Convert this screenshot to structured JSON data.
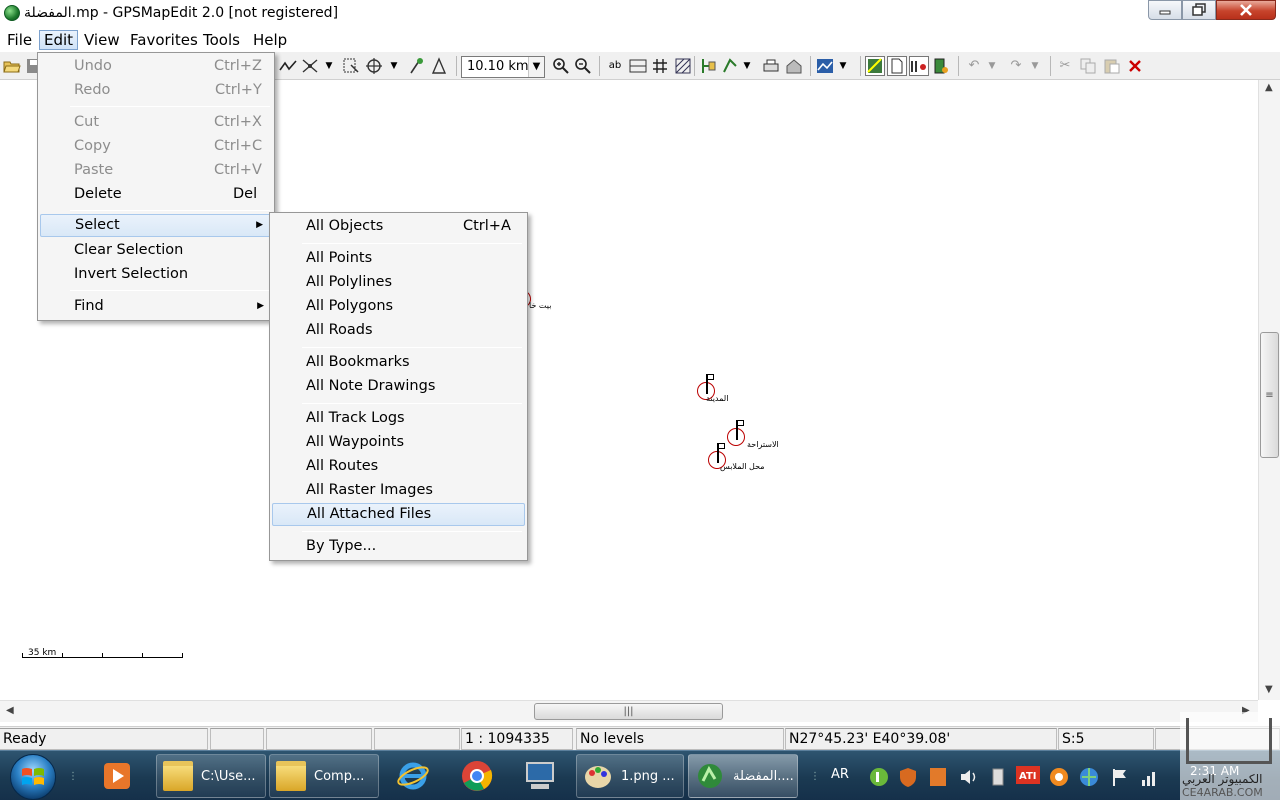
{
  "window": {
    "title": "المفضلة.mp - GPSMapEdit 2.0 [not registered]"
  },
  "menubar": {
    "file": "File",
    "edit": "Edit",
    "view": "View",
    "favorites": "Favorites",
    "tools": "Tools",
    "help": "Help"
  },
  "toolbar": {
    "zoom_value": "10.10 km"
  },
  "edit_menu": {
    "undo": "Undo",
    "undo_key": "Ctrl+Z",
    "redo": "Redo",
    "redo_key": "Ctrl+Y",
    "cut": "Cut",
    "cut_key": "Ctrl+X",
    "copy": "Copy",
    "copy_key": "Ctrl+C",
    "paste": "Paste",
    "paste_key": "Ctrl+V",
    "delete": "Delete",
    "delete_key": "Del",
    "select": "Select",
    "clear_selection": "Clear Selection",
    "invert_selection": "Invert Selection",
    "find": "Find"
  },
  "select_submenu": {
    "all_objects": "All Objects",
    "all_objects_key": "Ctrl+A",
    "all_points": "All Points",
    "all_polylines": "All Polylines",
    "all_polygons": "All Polygons",
    "all_roads": "All Roads",
    "all_bookmarks": "All Bookmarks",
    "all_note_drawings": "All Note Drawings",
    "all_track_logs": "All Track Logs",
    "all_waypoints": "All Waypoints",
    "all_routes": "All Routes",
    "all_raster_images": "All Raster Images",
    "all_attached_files": "All Attached Files",
    "by_type": "By Type..."
  },
  "map": {
    "poi_labels": [
      "بيت خا",
      "المدينة",
      "الاستراحة",
      "محل الملابس"
    ],
    "scale_label": "35 km"
  },
  "status": {
    "ready": "Ready",
    "scale": "1 : 1094335",
    "levels": "No levels",
    "coords": "N27°45.23' E40°39.08'",
    "s": "S:5"
  },
  "taskbar": {
    "items": [
      "C:\\Use...",
      "Comp...",
      "1.png ...",
      "المفضلة...."
    ],
    "lang": "AR"
  },
  "watermark": {
    "clock": "2:31 AM",
    "arabic": "الكمبيوتر العربي",
    "site": "CE4ARAB.COM"
  }
}
